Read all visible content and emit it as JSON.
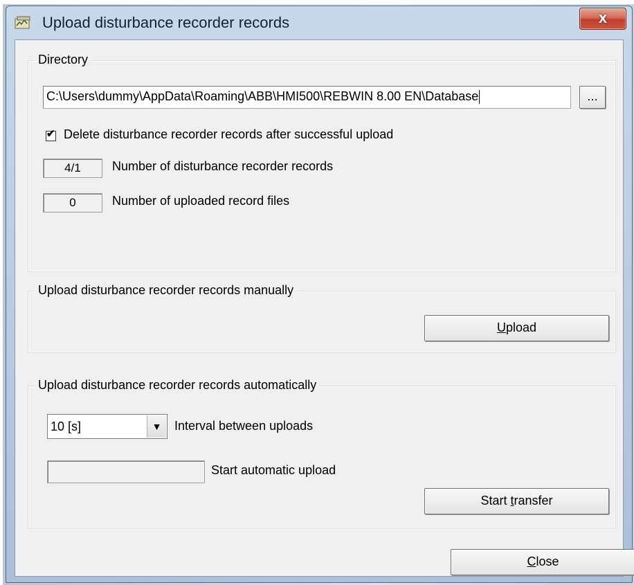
{
  "window": {
    "title": "Upload disturbance recorder records",
    "close_label": "x"
  },
  "directory": {
    "group_label": "Directory",
    "path_value": "C:\\Users\\dummy\\AppData\\Roaming\\ABB\\HMI500\\REBWIN 8.00 EN\\Database",
    "browse_label": "...",
    "delete_checkbox": {
      "checked": true,
      "label": "Delete disturbance recorder records after successful upload"
    },
    "records_count": {
      "value": "4/1",
      "label": "Number of disturbance recorder records"
    },
    "uploaded_count": {
      "value": "0",
      "label": "Number of uploaded record files"
    }
  },
  "manual": {
    "group_label": "Upload disturbance recorder records manually",
    "upload_mnemonic": "U",
    "upload_rest": "pload"
  },
  "automatic": {
    "group_label": "Upload disturbance recorder records automatically",
    "interval_value": "10 [s]",
    "interval_label": "Interval between uploads",
    "start_field_value": "",
    "start_label": "Start automatic upload",
    "start_transfer_pre": "Start ",
    "start_transfer_mnemonic": "t",
    "start_transfer_post": "ransfer"
  },
  "footer": {
    "close_mnemonic": "C",
    "close_rest": "lose"
  },
  "icons": {
    "app": "recorder-app-icon",
    "close": "close-icon",
    "dropdown": "chevron-down-icon",
    "check": "checkmark-icon"
  },
  "colors": {
    "title_bar": "#b9cce2",
    "close_button": "#c13f2b",
    "dialog_bg": "#f0f0f0"
  }
}
